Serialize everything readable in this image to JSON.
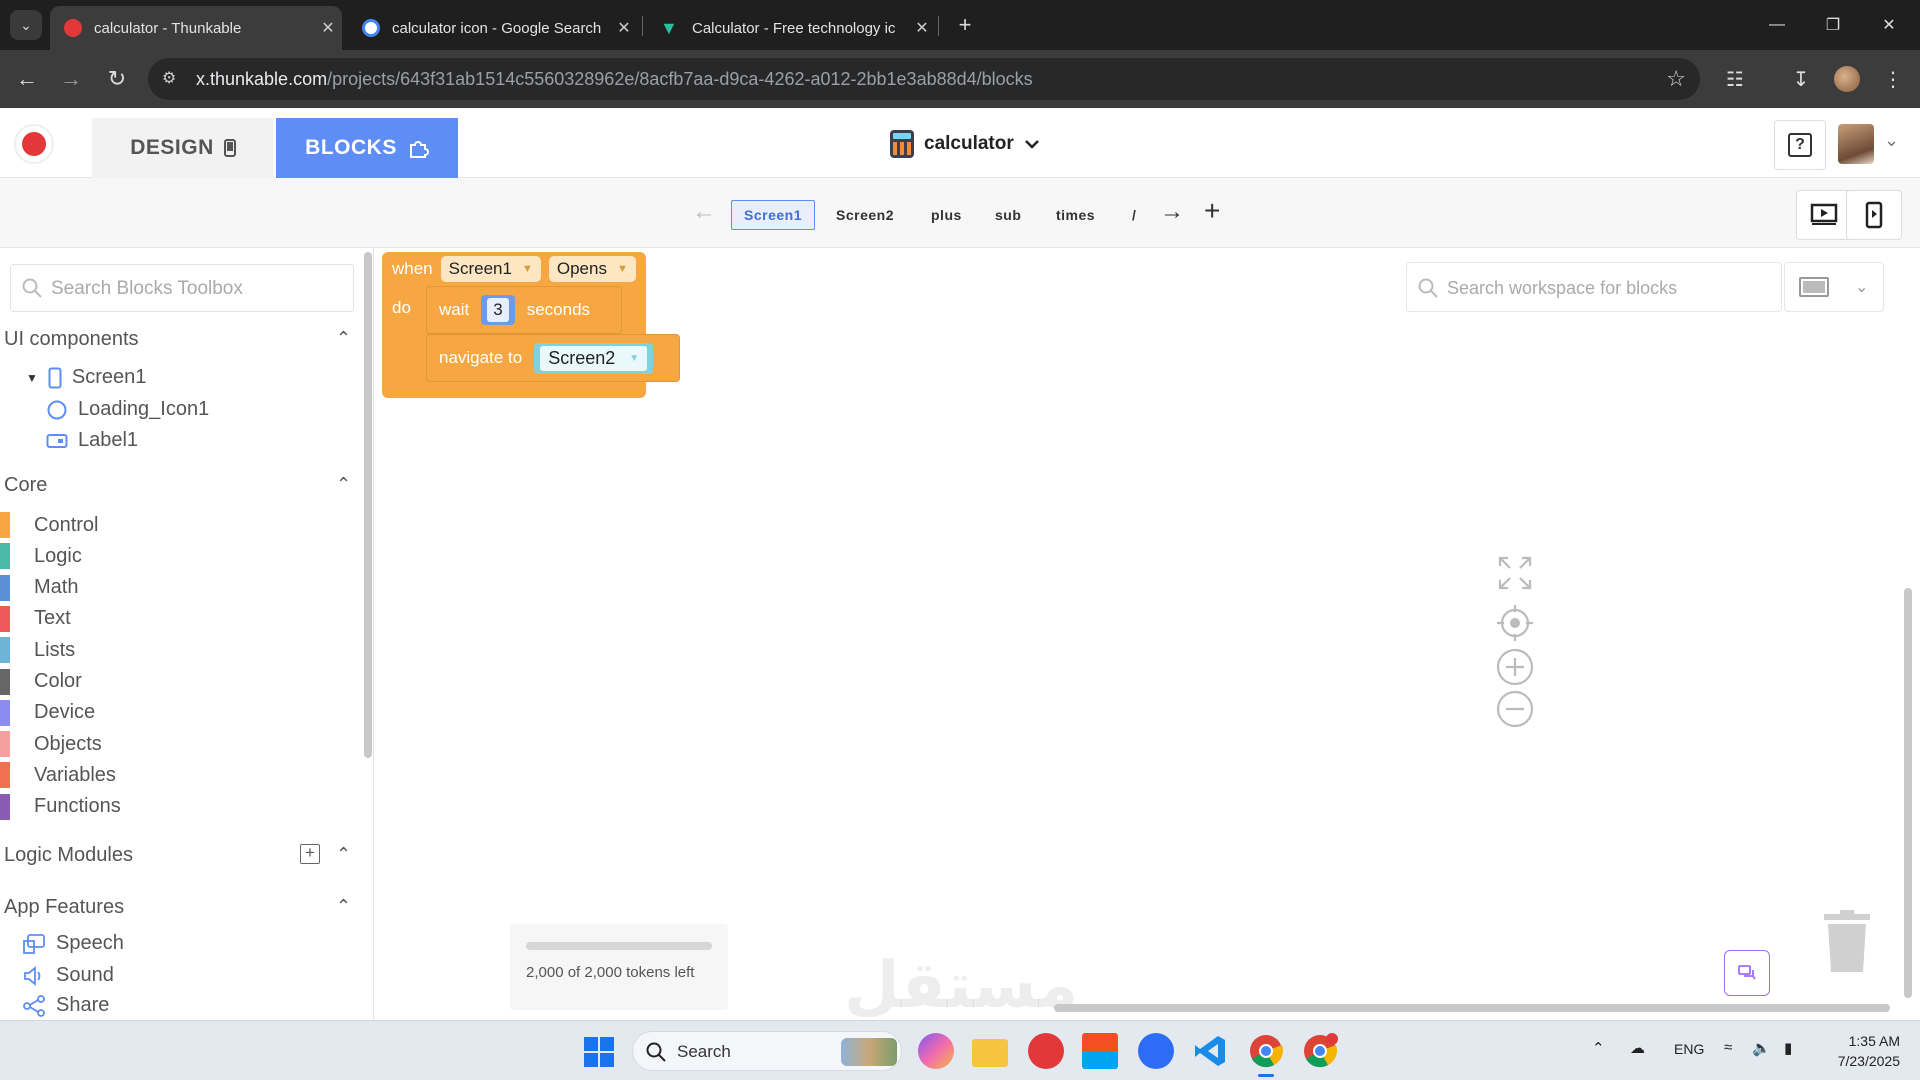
{
  "browser": {
    "tabs": [
      {
        "title": "calculator - Thunkable",
        "active": true,
        "favicon_color": "#e2383a"
      },
      {
        "title": "calculator icon - Google Search",
        "active": false,
        "favicon_color": "#ffffff"
      },
      {
        "title": "Calculator - Free technology ic",
        "active": false,
        "favicon_color": "#2bbfa4"
      }
    ],
    "url_host": "x.thunkable.com",
    "url_path": "/projects/643f31ab1514c5560328962e/8acfb7aa-d9ca-4262-a012-2bb1e3ab88d4/blocks"
  },
  "app": {
    "design_label": "DESIGN",
    "blocks_label": "BLOCKS",
    "project_name": "calculator",
    "help_label": "?"
  },
  "screens": {
    "tabs": [
      "Screen1",
      "Screen2",
      "plus",
      "sub",
      "times",
      "/"
    ],
    "active": "Screen1"
  },
  "sidebar": {
    "search_placeholder": "Search Blocks Toolbox",
    "ui_components_title": "UI components",
    "tree": [
      {
        "label": "Screen1",
        "icon": "phone-icon"
      },
      {
        "label": "Loading_Icon1",
        "icon": "spinner-icon"
      },
      {
        "label": "Label1",
        "icon": "label-icon"
      }
    ],
    "core_title": "Core",
    "core_items": [
      {
        "label": "Control",
        "color": "#f6a742"
      },
      {
        "label": "Logic",
        "color": "#4cb8a8"
      },
      {
        "label": "Math",
        "color": "#5b8fd6"
      },
      {
        "label": "Text",
        "color": "#ee5a5a"
      },
      {
        "label": "Lists",
        "color": "#6fb3d8"
      },
      {
        "label": "Color",
        "color": "#666666"
      },
      {
        "label": "Device",
        "color": "#8c8cf0"
      },
      {
        "label": "Objects",
        "color": "#f4a0a0"
      },
      {
        "label": "Variables",
        "color": "#f07050"
      },
      {
        "label": "Functions",
        "color": "#8a5bb0"
      }
    ],
    "logic_modules_title": "Logic Modules",
    "app_features_title": "App Features",
    "features": [
      {
        "label": "Speech",
        "icon": "speech-icon"
      },
      {
        "label": "Sound",
        "icon": "sound-icon"
      },
      {
        "label": "Share",
        "icon": "share-icon"
      }
    ]
  },
  "workspace": {
    "search_placeholder": "Search workspace for blocks",
    "event_block": {
      "when": "when",
      "component": "Screen1",
      "event": "Opens",
      "do": "do"
    },
    "wait_block": {
      "label": "wait",
      "value": "3",
      "unit": "seconds"
    },
    "navigate_block": {
      "label": "navigate to",
      "target": "Screen2"
    },
    "tokens": {
      "text": "2,000 of 2,000 tokens left",
      "fraction": 1.0
    }
  },
  "watermark": "مستقل",
  "taskbar": {
    "search_label": "Search",
    "tray_lang": "ENG",
    "time": "1:35 AM",
    "date": "7/23/2025"
  },
  "colors": {
    "blocks_tab": "#5d8df5",
    "control_block": "#f6a742",
    "number_block": "#6e9ae8",
    "screen_block": "#7fd2dc"
  }
}
